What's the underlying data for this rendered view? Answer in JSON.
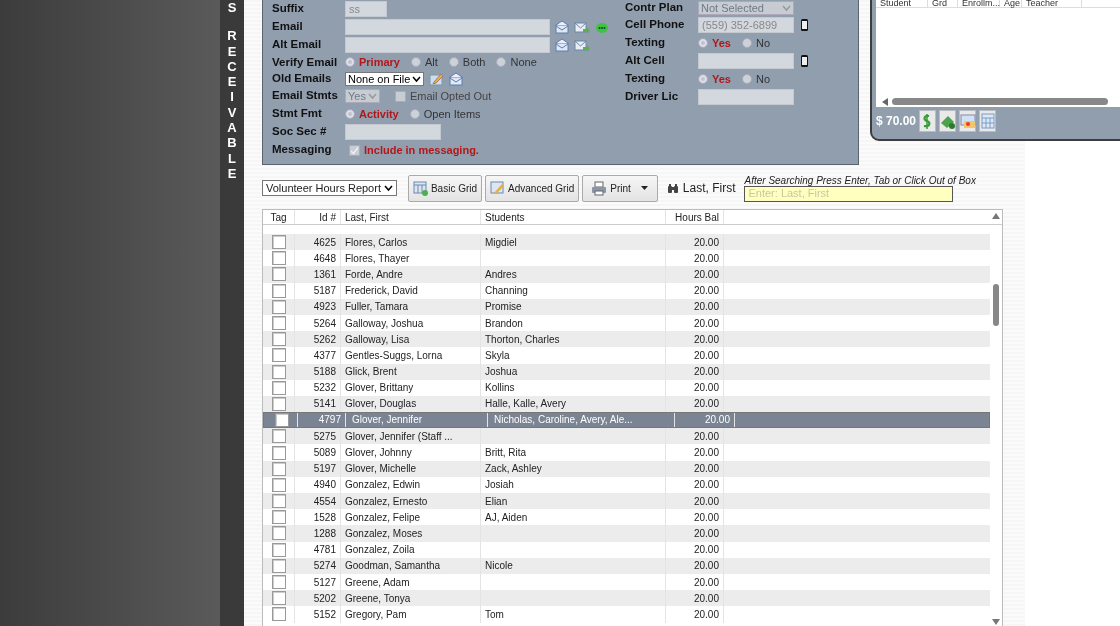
{
  "side_letters": [
    "S",
    "R",
    "E",
    "C",
    "E",
    "I",
    "V",
    "A",
    "B",
    "L",
    "E"
  ],
  "form": {
    "left": [
      {
        "kind": "short-input",
        "label": "Suffix",
        "value": "ss"
      },
      {
        "kind": "email-chat",
        "label": "Email"
      },
      {
        "kind": "email",
        "label": "Alt Email"
      },
      {
        "kind": "radio",
        "label": "Verify Email",
        "options": [
          {
            "label": "Primary",
            "selected": true
          },
          {
            "label": "Alt",
            "selected": false
          },
          {
            "label": "Both",
            "selected": false
          },
          {
            "label": "None",
            "selected": false
          }
        ]
      },
      {
        "kind": "old-emails",
        "label": "Old Emails",
        "value": "None on File"
      },
      {
        "kind": "select-check",
        "label": "Email Stmts",
        "value": "Yes",
        "check": {
          "label": "Email Opted Out",
          "checked": false
        }
      },
      {
        "kind": "radio",
        "label": "Stmt Fmt",
        "options": [
          {
            "label": "Activity",
            "selected": true
          },
          {
            "label": "Open Items",
            "selected": false
          }
        ]
      },
      {
        "kind": "input",
        "label": "Soc Sec #"
      },
      {
        "kind": "check",
        "label": "Messaging",
        "check": {
          "label": "Include in messaging.",
          "checked": true
        }
      }
    ],
    "right": [
      {
        "kind": "select",
        "label": "Contr Plan",
        "value": "Not Selected"
      },
      {
        "kind": "phone",
        "label": "Cell Phone",
        "value": "(559) 352-6899"
      },
      {
        "kind": "radio",
        "label": "Texting",
        "options": [
          {
            "label": "Yes",
            "selected": true
          },
          {
            "label": "No",
            "selected": false
          }
        ]
      },
      {
        "kind": "phone",
        "label": "Alt Cell"
      },
      {
        "kind": "radio",
        "label": "Texting",
        "options": [
          {
            "label": "Yes",
            "selected": true
          },
          {
            "label": "No",
            "selected": false
          }
        ]
      },
      {
        "kind": "input",
        "label": "Driver Lic"
      }
    ]
  },
  "popup": {
    "columns": [
      "Student",
      "Grd",
      "Enrollm...",
      "Age",
      "Teacher"
    ],
    "balance": "$ 70.00"
  },
  "toolbar": {
    "report": "Volunteer Hours Report",
    "buttons": [
      {
        "kind": "basic",
        "label": "Basic Grid"
      },
      {
        "kind": "advanced",
        "label": "Advanced Grid"
      },
      {
        "kind": "print",
        "label": "Print"
      }
    ],
    "search_label": "Last, First",
    "hint": "After Searching Press Enter, Tab or Click Out of Box",
    "search_placeholder": "Enter: Last, First"
  },
  "table": {
    "columns": [
      "Tag",
      "Id #",
      "Last, First",
      "Students",
      "Hours Bal"
    ],
    "rows": [
      {
        "id": "4625",
        "name": "Flores, Carlos",
        "students": "Migdiel",
        "hours": "20.00",
        "checked": false,
        "selected": false
      },
      {
        "id": "4648",
        "name": "Flores, Thayer",
        "students": "",
        "hours": "20.00",
        "checked": false,
        "selected": false
      },
      {
        "id": "1361",
        "name": "Forde, Andre",
        "students": "Andres",
        "hours": "20.00",
        "checked": false,
        "selected": false
      },
      {
        "id": "5187",
        "name": "Frederick, David",
        "students": "Channing",
        "hours": "20.00",
        "checked": false,
        "selected": false
      },
      {
        "id": "4923",
        "name": "Fuller, Tamara",
        "students": "Promise",
        "hours": "20.00",
        "checked": false,
        "selected": false
      },
      {
        "id": "5264",
        "name": "Galloway, Joshua",
        "students": "Brandon",
        "hours": "20.00",
        "checked": false,
        "selected": false
      },
      {
        "id": "5262",
        "name": "Galloway, Lisa",
        "students": "Thorton, Charles",
        "hours": "20.00",
        "checked": false,
        "selected": false
      },
      {
        "id": "4377",
        "name": "Gentles-Suggs, Lorna",
        "students": "Skyla",
        "hours": "20.00",
        "checked": false,
        "selected": false
      },
      {
        "id": "5188",
        "name": "Glick, Brent",
        "students": "Joshua",
        "hours": "20.00",
        "checked": false,
        "selected": false
      },
      {
        "id": "5232",
        "name": "Glover, Brittany",
        "students": "Kollins",
        "hours": "20.00",
        "checked": false,
        "selected": false
      },
      {
        "id": "5141",
        "name": "Glover, Douglas",
        "students": "Halle, Kalle, Avery",
        "hours": "20.00",
        "checked": false,
        "selected": false
      },
      {
        "id": "4797",
        "name": "Glover, Jennifer",
        "students": "Nicholas, Caroline, Avery, Ale...",
        "hours": "20.00",
        "checked": false,
        "selected": true
      },
      {
        "id": "5275",
        "name": "Glover, Jennifer (Staff ...",
        "students": "",
        "hours": "20.00",
        "checked": false,
        "selected": false
      },
      {
        "id": "5089",
        "name": "Glover, Johnny",
        "students": "Britt, Rita",
        "hours": "20.00",
        "checked": false,
        "selected": false
      },
      {
        "id": "5197",
        "name": "Glover, Michelle",
        "students": "Zack, Ashley",
        "hours": "20.00",
        "checked": false,
        "selected": false
      },
      {
        "id": "4940",
        "name": "Gonzalez, Edwin",
        "students": "Josiah",
        "hours": "20.00",
        "checked": false,
        "selected": false
      },
      {
        "id": "4554",
        "name": "Gonzalez, Ernesto",
        "students": "Elian",
        "hours": "20.00",
        "checked": false,
        "selected": false
      },
      {
        "id": "1528",
        "name": "Gonzalez, Felipe",
        "students": "AJ, Aiden",
        "hours": "20.00",
        "checked": false,
        "selected": false
      },
      {
        "id": "1288",
        "name": "Gonzalez, Moses",
        "students": "",
        "hours": "20.00",
        "checked": false,
        "selected": false
      },
      {
        "id": "4781",
        "name": "Gonzalez, Zoila",
        "students": "",
        "hours": "20.00",
        "checked": false,
        "selected": false
      },
      {
        "id": "5274",
        "name": "Goodman, Samantha",
        "students": "Nicole",
        "hours": "20.00",
        "checked": false,
        "selected": false
      },
      {
        "id": "5127",
        "name": "Greene, Adam",
        "students": "",
        "hours": "20.00",
        "checked": false,
        "selected": false
      },
      {
        "id": "5202",
        "name": "Greene, Tonya",
        "students": "",
        "hours": "20.00",
        "checked": false,
        "selected": false
      },
      {
        "id": "5152",
        "name": "Gregory, Pam",
        "students": "Tom",
        "hours": "20.00",
        "checked": false,
        "selected": false
      }
    ]
  }
}
